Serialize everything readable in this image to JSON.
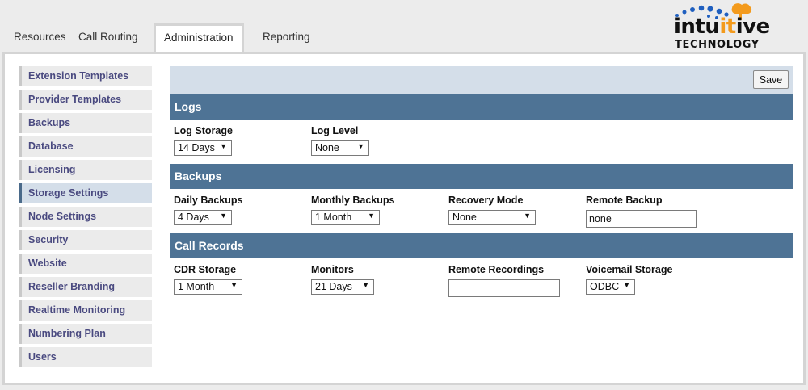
{
  "tabs": [
    {
      "label": "Resources"
    },
    {
      "label": "Call Routing"
    },
    {
      "label": "Administration"
    },
    {
      "label": "Reporting"
    }
  ],
  "logo": {
    "word_pre": "intu",
    "word_hl": "it",
    "word_post": "ive",
    "sub": "TECHNOLOGY",
    "accent_color": "#f39a1c",
    "dot_color": "#1f5fbf"
  },
  "sidebar": {
    "items": [
      {
        "label": "Extension Templates"
      },
      {
        "label": "Provider Templates"
      },
      {
        "label": "Backups"
      },
      {
        "label": "Database"
      },
      {
        "label": "Licensing"
      },
      {
        "label": "Storage Settings"
      },
      {
        "label": "Node Settings"
      },
      {
        "label": "Security"
      },
      {
        "label": "Website"
      },
      {
        "label": "Reseller Branding"
      },
      {
        "label": "Realtime Monitoring"
      },
      {
        "label": "Numbering Plan"
      },
      {
        "label": "Users"
      }
    ]
  },
  "toolbar": {
    "save_label": "Save"
  },
  "logs": {
    "title": "Logs",
    "log_storage": {
      "label": "Log Storage",
      "value": "14 Days"
    },
    "log_level": {
      "label": "Log Level",
      "value": "None"
    }
  },
  "backups": {
    "title": "Backups",
    "daily": {
      "label": "Daily Backups",
      "value": "4 Days"
    },
    "monthly": {
      "label": "Monthly Backups",
      "value": "1 Month"
    },
    "recovery": {
      "label": "Recovery Mode",
      "value": "None"
    },
    "remote": {
      "label": "Remote Backup",
      "value": "none"
    }
  },
  "call_records": {
    "title": "Call Records",
    "cdr": {
      "label": "CDR Storage",
      "value": "1 Month"
    },
    "monitors": {
      "label": "Monitors",
      "value": "21 Days"
    },
    "remote_recordings": {
      "label": "Remote Recordings",
      "value": ""
    },
    "voicemail": {
      "label": "Voicemail Storage",
      "value": "ODBC"
    }
  },
  "colors": {
    "section_header": "#4e7395",
    "toolbar": "#d4dee9",
    "sidebar_text": "#4a4a80"
  }
}
